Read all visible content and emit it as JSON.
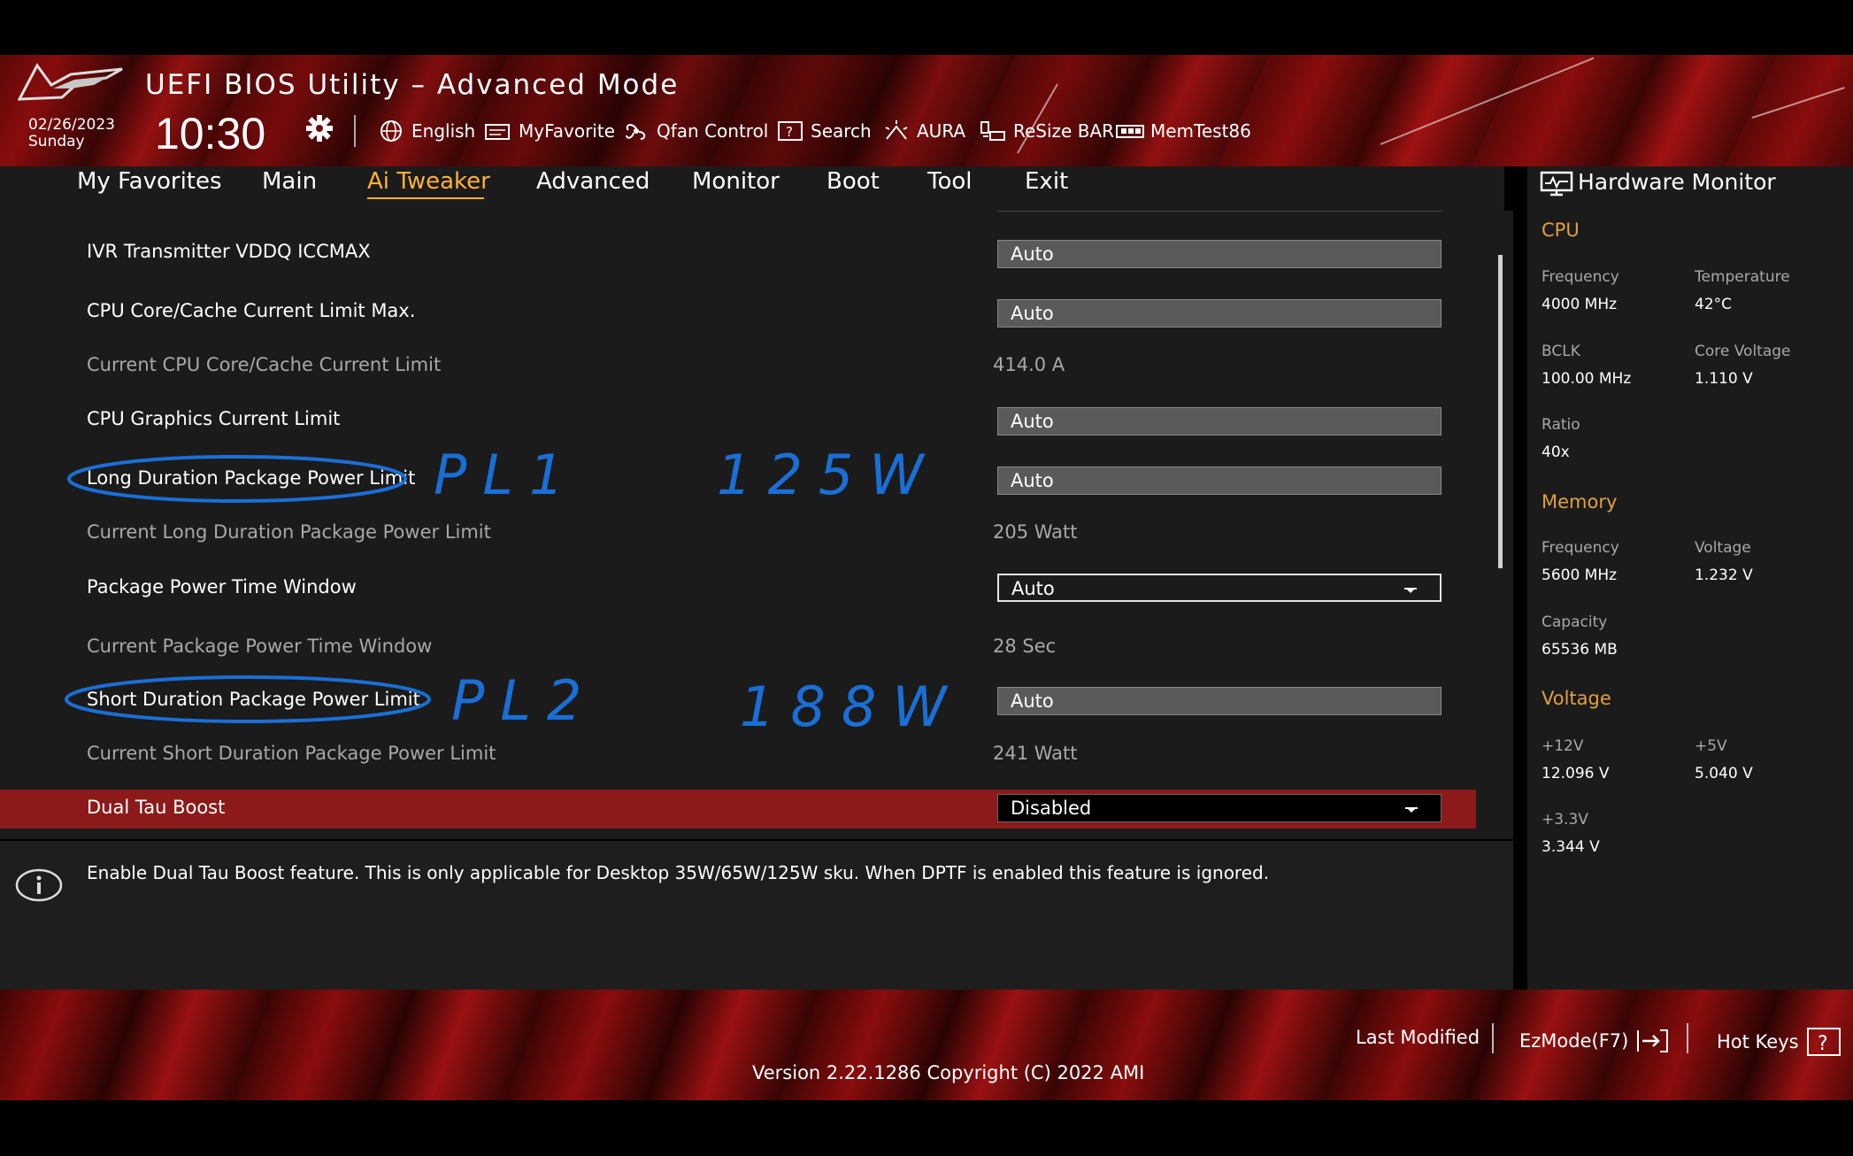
{
  "header": {
    "title": "UEFI BIOS Utility – Advanced Mode",
    "date": "02/26/2023",
    "day": "Sunday",
    "time": "10:30",
    "tools": [
      {
        "label": "English",
        "icon": "globe-icon"
      },
      {
        "label": "MyFavorite",
        "icon": "favorite-icon"
      },
      {
        "label": "Qfan Control",
        "icon": "fan-icon"
      },
      {
        "label": "Search",
        "icon": "search-icon"
      },
      {
        "label": "AURA",
        "icon": "aura-icon"
      },
      {
        "label": "ReSize BAR",
        "icon": "resize-bar-icon"
      },
      {
        "label": "MemTest86",
        "icon": "memtest-icon"
      }
    ]
  },
  "nav": {
    "tabs": [
      "My Favorites",
      "Main",
      "Ai Tweaker",
      "Advanced",
      "Monitor",
      "Boot",
      "Tool",
      "Exit"
    ],
    "active": "Ai Tweaker"
  },
  "settings": [
    {
      "label": "IVR Transmitter VDDQ ICCMAX",
      "value": "Auto",
      "kind": "field"
    },
    {
      "label": "CPU Core/Cache Current Limit Max.",
      "value": "Auto",
      "kind": "field"
    },
    {
      "label": "Current CPU Core/Cache Current Limit",
      "value": "414.0 A",
      "kind": "text"
    },
    {
      "label": "CPU Graphics Current Limit",
      "value": "Auto",
      "kind": "field"
    },
    {
      "label": "Long Duration Package Power Limit",
      "value": "Auto",
      "kind": "field"
    },
    {
      "label": "Current Long Duration Package Power Limit",
      "value": "205 Watt",
      "kind": "text"
    },
    {
      "label": "Package Power Time Window",
      "value": "Auto",
      "kind": "select"
    },
    {
      "label": "Current Package Power Time Window",
      "value": "28 Sec",
      "kind": "text"
    },
    {
      "label": "Short Duration Package Power Limit",
      "value": "Auto",
      "kind": "field"
    },
    {
      "label": "Current Short Duration Package Power Limit",
      "value": "241 Watt",
      "kind": "text"
    },
    {
      "label": "Dual Tau Boost",
      "value": "Disabled",
      "kind": "select",
      "selected": true
    }
  ],
  "annotations": {
    "pl1": "PL1",
    "pl1_value": "125W",
    "pl2": "PL2",
    "pl2_value": "188W",
    "color": "#1a6fd6"
  },
  "info": {
    "text": "Enable Dual Tau Boost feature. This is only applicable for Desktop 35W/65W/125W sku. When DPTF is enabled this feature is ignored."
  },
  "hardware_monitor": {
    "title": "Hardware Monitor",
    "cpu": {
      "heading": "CPU",
      "frequency_label": "Frequency",
      "frequency": "4000 MHz",
      "temperature_label": "Temperature",
      "temperature": "42°C",
      "bclk_label": "BCLK",
      "bclk": "100.00 MHz",
      "core_voltage_label": "Core Voltage",
      "core_voltage": "1.110 V",
      "ratio_label": "Ratio",
      "ratio": "40x"
    },
    "memory": {
      "heading": "Memory",
      "frequency_label": "Frequency",
      "frequency": "5600 MHz",
      "voltage_label": "Voltage",
      "voltage": "1.232 V",
      "capacity_label": "Capacity",
      "capacity": "65536 MB"
    },
    "voltage": {
      "heading": "Voltage",
      "v12_label": "+12V",
      "v12": "12.096 V",
      "v5_label": "+5V",
      "v5": "5.040 V",
      "v33_label": "+3.3V",
      "v33": "3.344 V"
    }
  },
  "footer": {
    "last_modified": "Last Modified",
    "ezmode": "EzMode(F7)",
    "hotkeys": "Hot Keys",
    "version": "Version 2.22.1286 Copyright (C) 2022 AMI"
  },
  "colors": {
    "accent": "#ffb13a",
    "highlight": "#8c1a1a",
    "section": "#e0a040"
  }
}
